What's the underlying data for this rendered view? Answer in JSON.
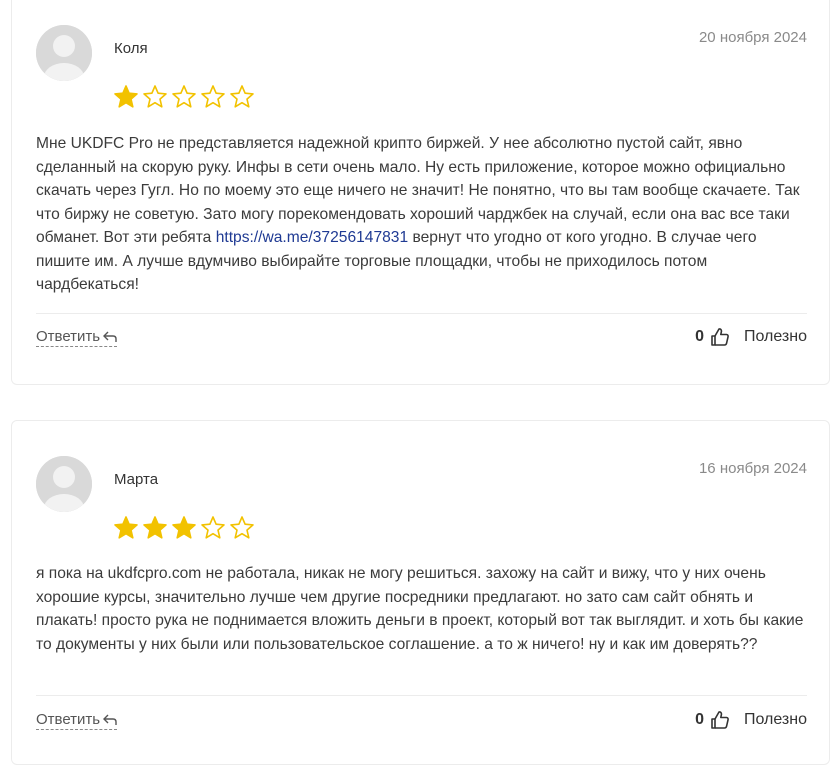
{
  "reviews": [
    {
      "author": "Коля",
      "date": "20 ноября 2024",
      "rating": 1,
      "max_rating": 5,
      "text_before_link": "Мне UKDFC Pro не представляется надежной крипто биржей. У нее абсолютно пустой сайт, явно сделанный на скорую руку. Инфы в сети очень мало. Ну есть приложение, которое можно официально скачать через Гугл. Но по моему это еще ничего не значит! Не понятно, что вы там вообще скачаете. Так что биржу не советую. Зато могу порекомендовать хороший чарджбек на случай, если она вас все таки обманет. Вот эти ребята ",
      "link_text": "https://wa.me/37256147831",
      "text_after_link": " вернут что угодно от кого угодно. В случае чего пишите им. А лучше вдумчиво выбирайте торговые площадки, чтобы не приходилось потом чардбекаться!",
      "reply_label": "Ответить",
      "helpful_count": "0",
      "helpful_label": "Полезно"
    },
    {
      "author": "Марта",
      "date": "16 ноября 2024",
      "rating": 3,
      "max_rating": 5,
      "text": "я пока на ukdfcpro.com не работала, никак не могу решиться. захожу на сайт и вижу, что у них очень хорошие курсы, значительно лучше чем другие посредники предлагают. но зато сам сайт обнять и плакать! просто рука не поднимается вложить деньги в проект, который вот так выглядит. и хоть бы какие то документы у них были или пользовательское соглашение. а то ж ничего! ну и как им доверять??",
      "reply_label": "Ответить",
      "helpful_count": "0",
      "helpful_label": "Полезно"
    }
  ],
  "colors": {
    "star_filled": "#f2c200",
    "star_outline": "#f2c200",
    "link": "#1f3a93",
    "date": "#8a8a8a",
    "avatar_bg": "#d9d9d9"
  }
}
